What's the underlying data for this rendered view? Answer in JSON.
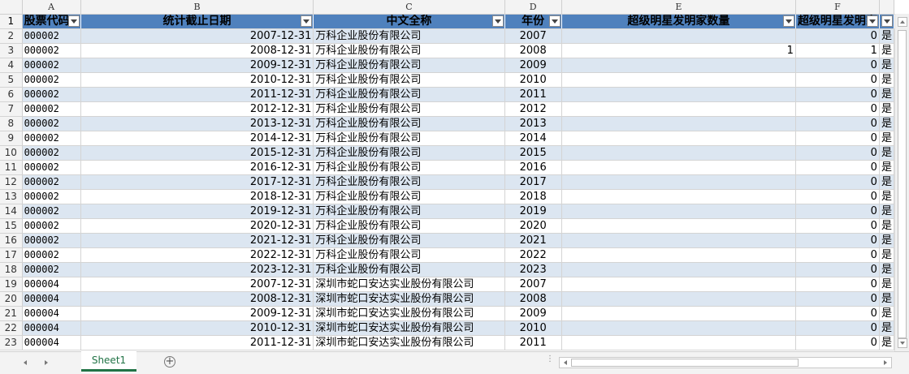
{
  "columns": [
    "A",
    "B",
    "C",
    "D",
    "E",
    "F"
  ],
  "headers": [
    "股票代码",
    "统计截止日期",
    "中文全称",
    "年份",
    "超级明星发明家数量",
    "超级明星发明家"
  ],
  "rows": [
    {
      "r": "2",
      "code": "000002",
      "date": "2007-12-31",
      "name": "万科企业股份有限公司",
      "year": "2007",
      "e": "",
      "f": "0",
      "g": "是"
    },
    {
      "r": "3",
      "code": "000002",
      "date": "2008-12-31",
      "name": "万科企业股份有限公司",
      "year": "2008",
      "e": "1",
      "f": "1",
      "g": "是"
    },
    {
      "r": "4",
      "code": "000002",
      "date": "2009-12-31",
      "name": "万科企业股份有限公司",
      "year": "2009",
      "e": "",
      "f": "0",
      "g": "是"
    },
    {
      "r": "5",
      "code": "000002",
      "date": "2010-12-31",
      "name": "万科企业股份有限公司",
      "year": "2010",
      "e": "",
      "f": "0",
      "g": "是"
    },
    {
      "r": "6",
      "code": "000002",
      "date": "2011-12-31",
      "name": "万科企业股份有限公司",
      "year": "2011",
      "e": "",
      "f": "0",
      "g": "是"
    },
    {
      "r": "7",
      "code": "000002",
      "date": "2012-12-31",
      "name": "万科企业股份有限公司",
      "year": "2012",
      "e": "",
      "f": "0",
      "g": "是"
    },
    {
      "r": "8",
      "code": "000002",
      "date": "2013-12-31",
      "name": "万科企业股份有限公司",
      "year": "2013",
      "e": "",
      "f": "0",
      "g": "是"
    },
    {
      "r": "9",
      "code": "000002",
      "date": "2014-12-31",
      "name": "万科企业股份有限公司",
      "year": "2014",
      "e": "",
      "f": "0",
      "g": "是"
    },
    {
      "r": "10",
      "code": "000002",
      "date": "2015-12-31",
      "name": "万科企业股份有限公司",
      "year": "2015",
      "e": "",
      "f": "0",
      "g": "是"
    },
    {
      "r": "11",
      "code": "000002",
      "date": "2016-12-31",
      "name": "万科企业股份有限公司",
      "year": "2016",
      "e": "",
      "f": "0",
      "g": "是"
    },
    {
      "r": "12",
      "code": "000002",
      "date": "2017-12-31",
      "name": "万科企业股份有限公司",
      "year": "2017",
      "e": "",
      "f": "0",
      "g": "是"
    },
    {
      "r": "13",
      "code": "000002",
      "date": "2018-12-31",
      "name": "万科企业股份有限公司",
      "year": "2018",
      "e": "",
      "f": "0",
      "g": "是"
    },
    {
      "r": "14",
      "code": "000002",
      "date": "2019-12-31",
      "name": "万科企业股份有限公司",
      "year": "2019",
      "e": "",
      "f": "0",
      "g": "是"
    },
    {
      "r": "15",
      "code": "000002",
      "date": "2020-12-31",
      "name": "万科企业股份有限公司",
      "year": "2020",
      "e": "",
      "f": "0",
      "g": "是"
    },
    {
      "r": "16",
      "code": "000002",
      "date": "2021-12-31",
      "name": "万科企业股份有限公司",
      "year": "2021",
      "e": "",
      "f": "0",
      "g": "是"
    },
    {
      "r": "17",
      "code": "000002",
      "date": "2022-12-31",
      "name": "万科企业股份有限公司",
      "year": "2022",
      "e": "",
      "f": "0",
      "g": "是"
    },
    {
      "r": "18",
      "code": "000002",
      "date": "2023-12-31",
      "name": "万科企业股份有限公司",
      "year": "2023",
      "e": "",
      "f": "0",
      "g": "是"
    },
    {
      "r": "19",
      "code": "000004",
      "date": "2007-12-31",
      "name": "深圳市蛇口安达实业股份有限公司",
      "year": "2007",
      "e": "",
      "f": "0",
      "g": "是"
    },
    {
      "r": "20",
      "code": "000004",
      "date": "2008-12-31",
      "name": "深圳市蛇口安达实业股份有限公司",
      "year": "2008",
      "e": "",
      "f": "0",
      "g": "是"
    },
    {
      "r": "21",
      "code": "000004",
      "date": "2009-12-31",
      "name": "深圳市蛇口安达实业股份有限公司",
      "year": "2009",
      "e": "",
      "f": "0",
      "g": "是"
    },
    {
      "r": "22",
      "code": "000004",
      "date": "2010-12-31",
      "name": "深圳市蛇口安达实业股份有限公司",
      "year": "2010",
      "e": "",
      "f": "0",
      "g": "是"
    },
    {
      "r": "23",
      "code": "000004",
      "date": "2011-12-31",
      "name": "深圳市蛇口安达实业股份有限公司",
      "year": "2011",
      "e": "",
      "f": "0",
      "g": "是"
    }
  ],
  "sheet_tab": "Sheet1",
  "add_sheet_symbol": "+",
  "colors": {
    "header_fill": "#4f81bd",
    "band_fill": "#dce6f1",
    "tab_accent": "#217346"
  }
}
